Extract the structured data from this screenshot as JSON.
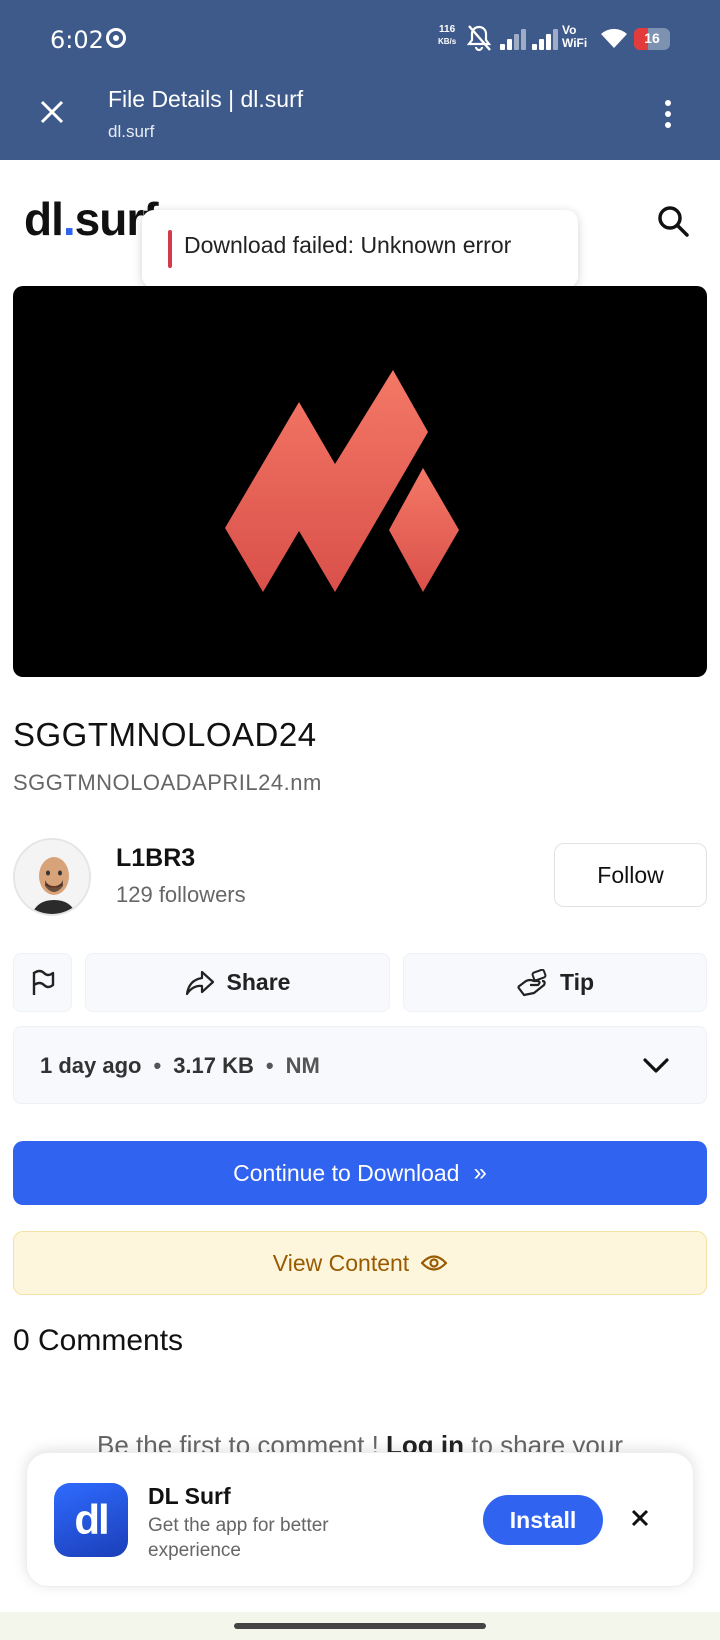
{
  "status_bar": {
    "time": "6:02",
    "net_speed": "116",
    "net_unit": "KB/s",
    "vowifi_1": "Vo",
    "vowifi_2": "WiFi",
    "battery": "16"
  },
  "tab": {
    "title": "File Details | dl.surf",
    "url": "dl.surf"
  },
  "site": {
    "logo_prefix": "dl",
    "logo_dot": ".",
    "logo_suffix": "surf"
  },
  "toast": {
    "message": "Download failed: Unknown error"
  },
  "file": {
    "title": "SGGTMNOLOAD24",
    "filename": "SGGTMNOLOADAPRIL24.nm"
  },
  "uploader": {
    "name": "L1BR3",
    "followers": "129 followers",
    "follow_label": "Follow"
  },
  "actions": {
    "share_label": "Share",
    "tip_label": "Tip"
  },
  "meta": {
    "age": "1 day ago",
    "size": "3.17 KB",
    "ext": "NM",
    "separator": "•"
  },
  "buttons": {
    "download_label": "Continue to Download",
    "download_arrows": "»",
    "view_label": "View Content"
  },
  "comments": {
    "heading": "0 Comments",
    "cta_prefix": "Be the first to comment ! ",
    "cta_link": "Log in",
    "cta_suffix": " to share your"
  },
  "app_banner": {
    "icon_text": "dl",
    "name": "DL Surf",
    "description": "Get the app for better experience",
    "install_label": "Install"
  },
  "colors": {
    "header": "#3d5a8a",
    "accent": "#2f63f0",
    "logo_shape": "#f07065",
    "error": "#d33a4a",
    "view_bg": "#fdf6dc",
    "view_text": "#9a5a00"
  }
}
